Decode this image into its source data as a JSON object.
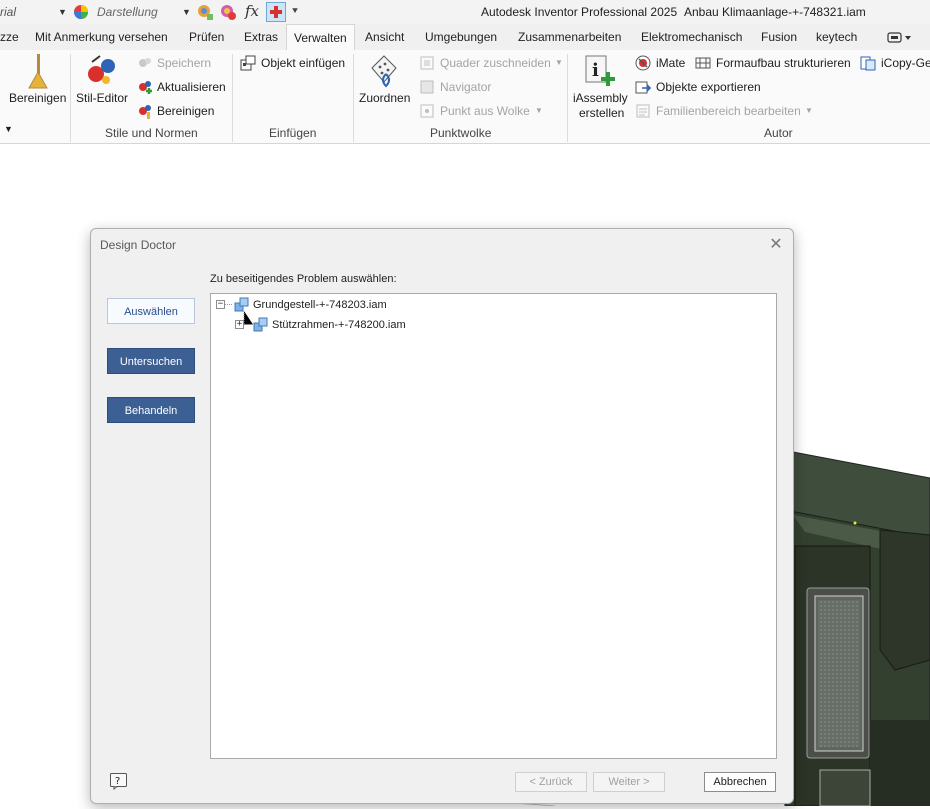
{
  "title_bar": {
    "font_value": "rial",
    "appearance_value": "Darstellung",
    "app_title": "Autodesk Inventor Professional 2025",
    "document_title": "Anbau Klimaanlage-+-748321.iam",
    "fx_label": "fx"
  },
  "tabs": [
    {
      "label": "zze"
    },
    {
      "label": "Mit Anmerkung versehen"
    },
    {
      "label": "Prüfen"
    },
    {
      "label": "Extras"
    },
    {
      "label": "Verwalten",
      "active": true
    },
    {
      "label": "Ansicht"
    },
    {
      "label": "Umgebungen"
    },
    {
      "label": "Zusammenarbeiten"
    },
    {
      "label": "Elektromechanisch"
    },
    {
      "label": "Fusion"
    },
    {
      "label": "keytech"
    }
  ],
  "ribbon": {
    "bereinigen_large": "Bereinigen",
    "stil_editor": "Stil-Editor",
    "speichern": "Speichern",
    "aktualisieren": "Aktualisieren",
    "bereinigen_small": "Bereinigen",
    "objekt_einfuegen": "Objekt einfügen",
    "zuordnen": "Zuordnen",
    "quader_zuschneiden": "Quader zuschneiden",
    "navigator": "Navigator",
    "punkt_aus_wolke": "Punkt aus Wolke",
    "iassembly_line1": "iAssembly",
    "iassembly_line2": "erstellen",
    "imate": "iMate",
    "formaufbau": "Formaufbau strukturieren",
    "icopy": "iCopy-Ge",
    "objekte_exportieren": "Objekte exportieren",
    "familienbereich": "Familienbereich bearbeiten",
    "groups": {
      "stile": "Stile und Normen",
      "einfuegen": "Einfügen",
      "punktwolke": "Punktwolke",
      "autor": "Autor"
    }
  },
  "dialog": {
    "title": "Design Doctor",
    "prompt": "Zu beseitigendes Problem auswählen:",
    "steps": {
      "auswaehlen": "Auswählen",
      "untersuchen": "Untersuchen",
      "behandeln": "Behandeln"
    },
    "tree": [
      {
        "label": "Grundgestell-+-748203.iam",
        "expander": "−"
      },
      {
        "label": "Stützrahmen-+-748200.iam",
        "expander": "+"
      }
    ],
    "buttons": {
      "back": "< Zurück",
      "next": "Weiter >",
      "cancel": "Abbrechen"
    },
    "help_glyph": "?"
  },
  "colors": {
    "primary_button": "#3c5f94",
    "model_body": "#3a4a3c"
  }
}
